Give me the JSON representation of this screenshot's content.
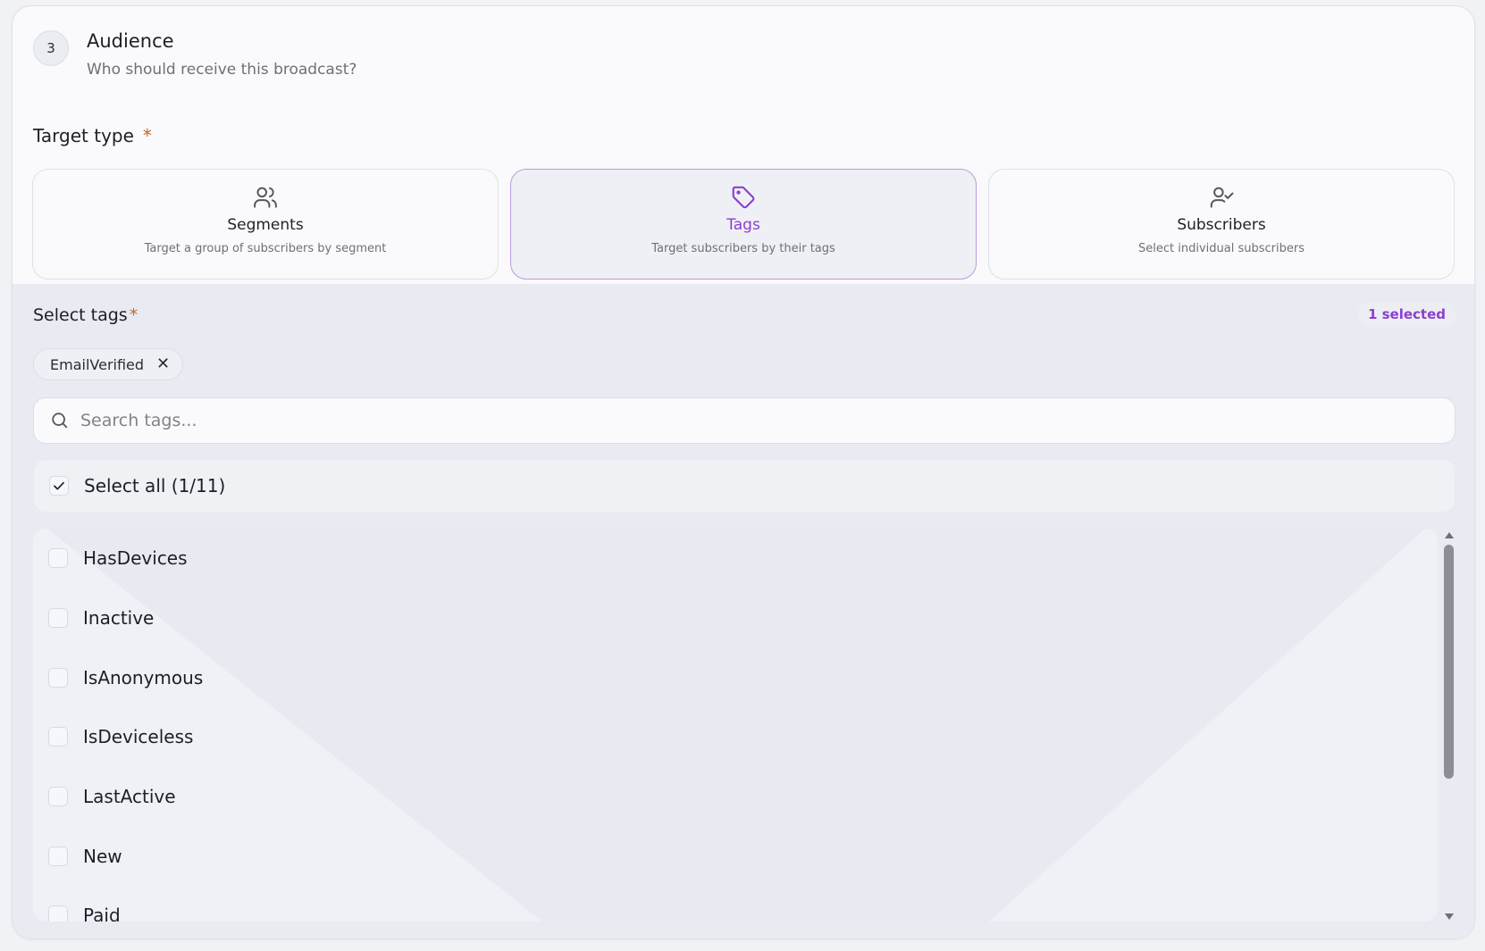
{
  "header": {
    "step_number": "3",
    "title": "Audience",
    "subtitle": "Who should receive this broadcast?"
  },
  "target_type": {
    "label": "Target type",
    "required_mark": "*",
    "options": [
      {
        "title": "Segments",
        "description": "Target a group of subscribers by segment",
        "icon": "users-icon",
        "selected": false
      },
      {
        "title": "Tags",
        "description": "Target subscribers by their tags",
        "icon": "tag-icon",
        "selected": true
      },
      {
        "title": "Subscribers",
        "description": "Select individual subscribers",
        "icon": "user-check-icon",
        "selected": false
      }
    ]
  },
  "tags": {
    "label": "Select tags",
    "required_mark": "*",
    "selected_count": "1 selected",
    "chips": [
      "EmailVerified"
    ],
    "chip_remove_glyph": "✕",
    "search_placeholder": "Search tags...",
    "search_value": "",
    "select_all_label": "Select all (1/11)",
    "items": [
      {
        "label": "HasDevices",
        "checked": false
      },
      {
        "label": "Inactive",
        "checked": false
      },
      {
        "label": "IsAnonymous",
        "checked": false
      },
      {
        "label": "IsDeviceless",
        "checked": false
      },
      {
        "label": "LastActive",
        "checked": false
      },
      {
        "label": "New",
        "checked": false
      },
      {
        "label": "Paid",
        "checked": false
      }
    ]
  },
  "colors": {
    "accent": "#8d3fce",
    "required": "#c2682a"
  }
}
